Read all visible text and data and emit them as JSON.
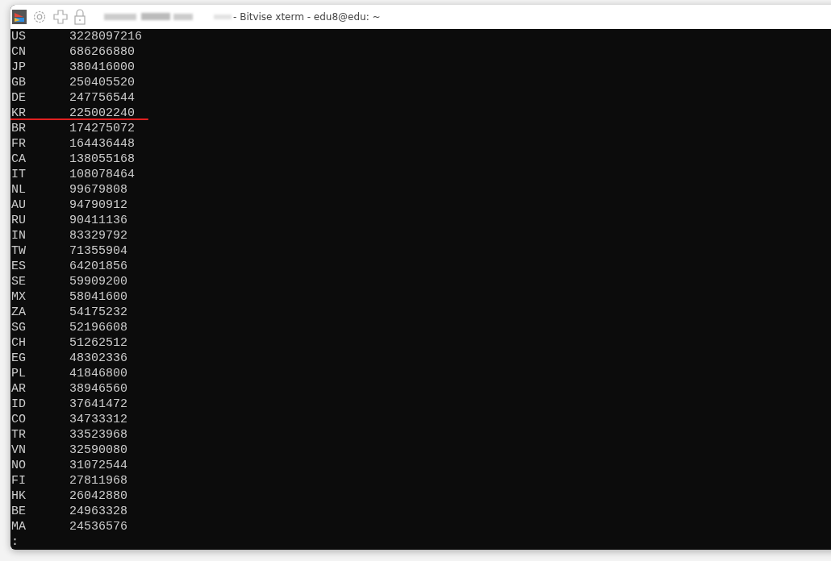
{
  "window": {
    "title": "- Bitvise xterm - edu8@edu: ~"
  },
  "terminal": {
    "rows": [
      {
        "code": "US",
        "value": "3228097216",
        "underlined": false
      },
      {
        "code": "CN",
        "value": "686266880",
        "underlined": false
      },
      {
        "code": "JP",
        "value": "380416000",
        "underlined": false
      },
      {
        "code": "GB",
        "value": "250405520",
        "underlined": false
      },
      {
        "code": "DE",
        "value": "247756544",
        "underlined": false
      },
      {
        "code": "KR",
        "value": "225002240",
        "underlined": true
      },
      {
        "code": "BR",
        "value": "174275072",
        "underlined": false
      },
      {
        "code": "FR",
        "value": "164436448",
        "underlined": false
      },
      {
        "code": "CA",
        "value": "138055168",
        "underlined": false
      },
      {
        "code": "IT",
        "value": "108078464",
        "underlined": false
      },
      {
        "code": "NL",
        "value": "99679808",
        "underlined": false
      },
      {
        "code": "AU",
        "value": "94790912",
        "underlined": false
      },
      {
        "code": "RU",
        "value": "90411136",
        "underlined": false
      },
      {
        "code": "IN",
        "value": "83329792",
        "underlined": false
      },
      {
        "code": "TW",
        "value": "71355904",
        "underlined": false
      },
      {
        "code": "ES",
        "value": "64201856",
        "underlined": false
      },
      {
        "code": "SE",
        "value": "59909200",
        "underlined": false
      },
      {
        "code": "MX",
        "value": "58041600",
        "underlined": false
      },
      {
        "code": "ZA",
        "value": "54175232",
        "underlined": false
      },
      {
        "code": "SG",
        "value": "52196608",
        "underlined": false
      },
      {
        "code": "CH",
        "value": "51262512",
        "underlined": false
      },
      {
        "code": "EG",
        "value": "48302336",
        "underlined": false
      },
      {
        "code": "PL",
        "value": "41846800",
        "underlined": false
      },
      {
        "code": "AR",
        "value": "38946560",
        "underlined": false
      },
      {
        "code": "ID",
        "value": "37641472",
        "underlined": false
      },
      {
        "code": "CO",
        "value": "34733312",
        "underlined": false
      },
      {
        "code": "TR",
        "value": "33523968",
        "underlined": false
      },
      {
        "code": "VN",
        "value": "32590080",
        "underlined": false
      },
      {
        "code": "NO",
        "value": "31072544",
        "underlined": false
      },
      {
        "code": "FI",
        "value": "27811968",
        "underlined": false
      },
      {
        "code": "HK",
        "value": "26042880",
        "underlined": false
      },
      {
        "code": "BE",
        "value": "24963328",
        "underlined": false
      },
      {
        "code": "MA",
        "value": "24536576",
        "underlined": false
      }
    ],
    "prompt": ":"
  }
}
